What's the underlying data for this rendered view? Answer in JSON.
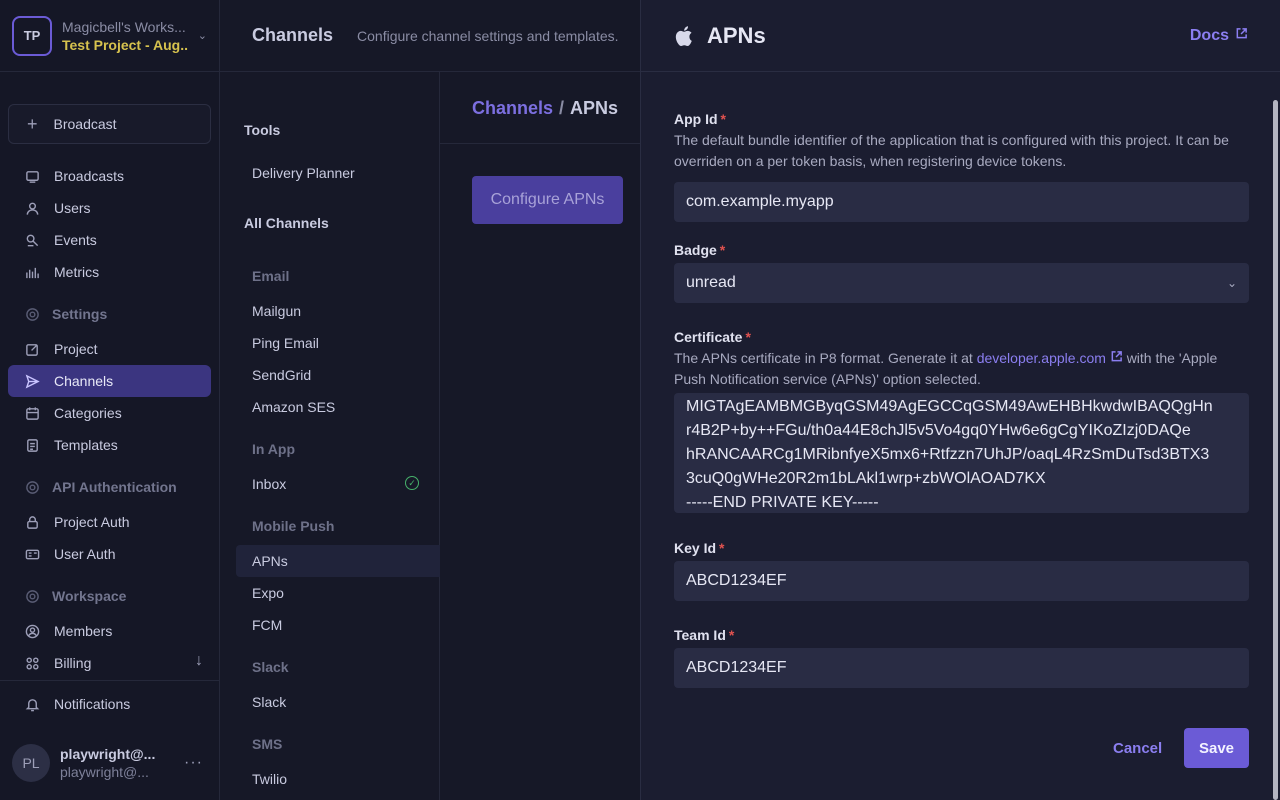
{
  "workspace": {
    "initials": "TP",
    "name": "Magicbell's Works...",
    "project": "Test Project - Aug..."
  },
  "sidebar": {
    "broadcast_button": "Broadcast",
    "items": [
      {
        "label": "Broadcasts",
        "icon": "broadcast-icon"
      },
      {
        "label": "Users",
        "icon": "user-icon"
      },
      {
        "label": "Events",
        "icon": "events-icon"
      },
      {
        "label": "Metrics",
        "icon": "metrics-icon"
      }
    ],
    "settings_header": "Settings",
    "settings_items": [
      {
        "label": "Project",
        "icon": "edit-icon"
      },
      {
        "label": "Channels",
        "icon": "send-icon",
        "active": true
      },
      {
        "label": "Categories",
        "icon": "calendar-icon"
      },
      {
        "label": "Templates",
        "icon": "document-icon"
      }
    ],
    "api_header": "API Authentication",
    "api_items": [
      {
        "label": "Project Auth",
        "icon": "lock-icon"
      },
      {
        "label": "User Auth",
        "icon": "id-card-icon"
      }
    ],
    "workspace_header": "Workspace",
    "workspace_items": [
      {
        "label": "Members",
        "icon": "members-icon"
      },
      {
        "label": "Billing",
        "icon": "billing-icon"
      }
    ],
    "notifications": "Notifications",
    "user": {
      "initials": "PL",
      "name": "playwright@...",
      "email": "playwright@..."
    }
  },
  "topbar": {
    "title": "Channels",
    "subtitle": "Configure channel settings and templates."
  },
  "channels_list": {
    "tools_header": "Tools",
    "delivery_planner": "Delivery Planner",
    "all_channels_header": "All Channels",
    "groups": {
      "email": "Email",
      "in_app": "In App",
      "mobile_push": "Mobile Push",
      "slack": "Slack",
      "sms": "SMS"
    },
    "email_items": [
      "Mailgun",
      "Ping Email",
      "SendGrid",
      "Amazon SES"
    ],
    "in_app_items": [
      "Inbox"
    ],
    "mobile_push_items": [
      "APNs",
      "Expo",
      "FCM"
    ],
    "slack_items": [
      "Slack"
    ],
    "sms_items": [
      "Twilio"
    ]
  },
  "content": {
    "breadcrumb_root": "Channels",
    "breadcrumb_sep": "/",
    "breadcrumb_current": "APNs",
    "configure_button": "Configure APNs"
  },
  "drawer": {
    "title": "APNs",
    "docs_link": "Docs",
    "fields": {
      "app_id": {
        "label": "App Id",
        "help": "The default bundle identifier of the application that is configured with this project. It can be overriden on a per token basis, when registering device tokens.",
        "value": "com.example.myapp"
      },
      "badge": {
        "label": "Badge",
        "value": "unread"
      },
      "certificate": {
        "label": "Certificate",
        "help_prefix": "The APNs certificate in P8 format. Generate it at",
        "help_link": "developer.apple.com",
        "help_suffix": "with the 'Apple Push Notification service (APNs)' option selected.",
        "lines": [
          "MIGTAgEAMBMGByqGSM49AgEGCCqGSM49AwEHBHkwdwIBAQQgHn",
          "r4B2P+by++FGu/th0a44E8chJl5v5Vo4gq0YHw6e6gCgYIKoZIzj0DAQe",
          "hRANCAARCg1MRibnfyeX5mx6+Rtfzzn7UhJP/oaqL4RzSmDuTsd3BTX3",
          "3cuQ0gWHe20R2m1bLAkl1wrp+zbWOlAOAD7KX",
          "-----END PRIVATE KEY-----"
        ]
      },
      "key_id": {
        "label": "Key Id",
        "value": "ABCD1234EF"
      },
      "team_id": {
        "label": "Team Id",
        "value": "ABCD1234EF"
      }
    },
    "required_mark": "*",
    "cancel": "Cancel",
    "save": "Save"
  },
  "colors": {
    "accent": "#6b5bd6",
    "link": "#8b7ef0",
    "project_name": "#d6c24e",
    "required": "#e0524f",
    "success": "#46b06a"
  }
}
